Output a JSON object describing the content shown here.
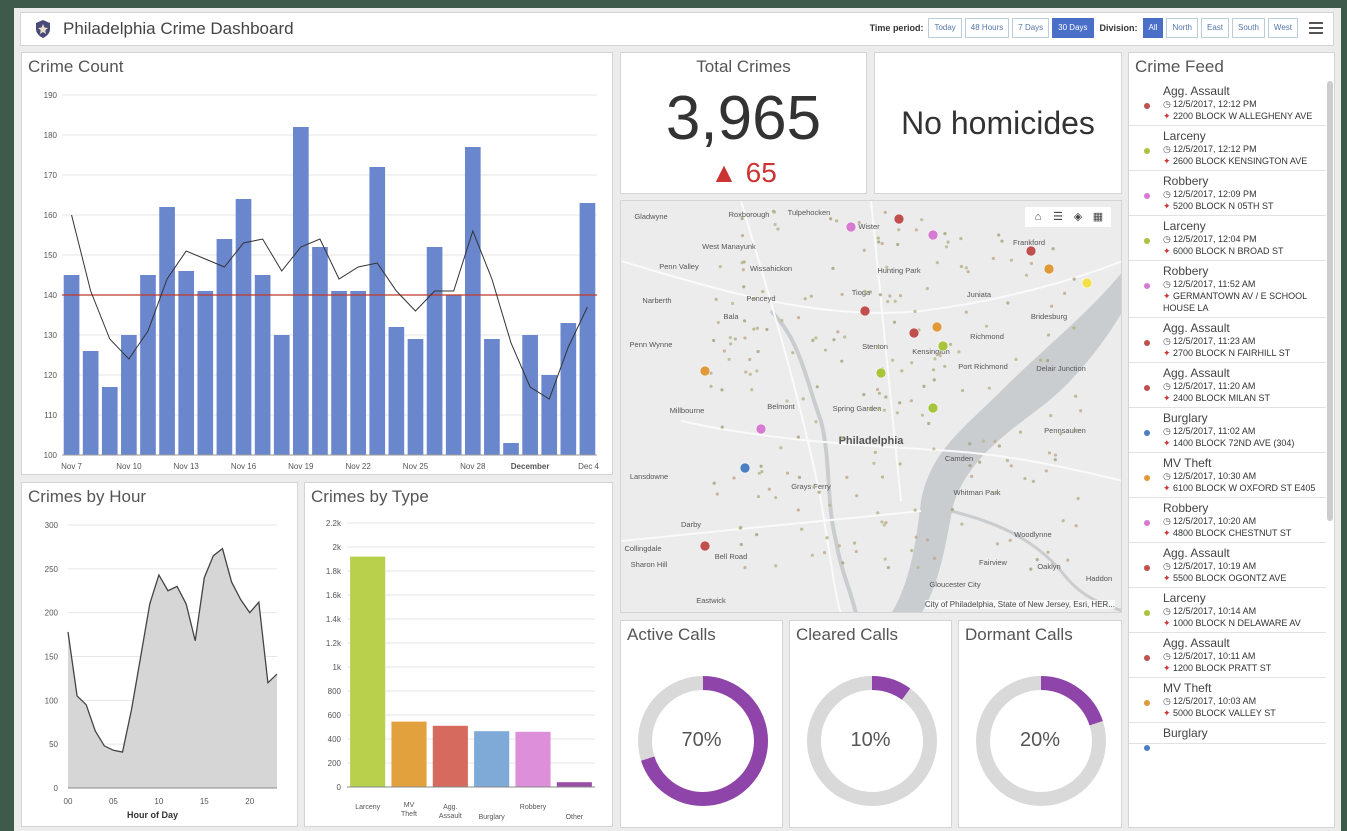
{
  "header": {
    "title": "Philadelphia Crime Dashboard",
    "time_label": "Time period:",
    "time_options": [
      "Today",
      "48 Hours",
      "7 Days",
      "30 Days"
    ],
    "time_selected": "30 Days",
    "division_label": "Division:",
    "division_options": [
      "All",
      "North",
      "East",
      "South",
      "West"
    ],
    "division_selected": "All"
  },
  "crime_count": {
    "title": "Crime Count",
    "chart_data": {
      "type": "bar",
      "title": "Crime Count",
      "yticks": [
        100,
        110,
        120,
        130,
        140,
        150,
        160,
        170,
        180,
        190
      ],
      "ylim": [
        100,
        190
      ],
      "xtick_labels": [
        "Nov 7",
        "Nov 10",
        "Nov 13",
        "Nov 16",
        "Nov 19",
        "Nov 22",
        "Nov 25",
        "Nov 28",
        "December",
        "Dec 4"
      ],
      "values": [
        145,
        126,
        117,
        130,
        145,
        162,
        146,
        141,
        154,
        164,
        145,
        130,
        182,
        152,
        141,
        141,
        172,
        132,
        129,
        152,
        140,
        177,
        129,
        103,
        130,
        120,
        133,
        163
      ],
      "trend": [
        160,
        141,
        129,
        124,
        131,
        144,
        151,
        149,
        147,
        153,
        154,
        146,
        152,
        154,
        144,
        147,
        148,
        141,
        136,
        141,
        141,
        156,
        144,
        128,
        117,
        114,
        127,
        137
      ],
      "reference_line": 140,
      "bar_color": "#6a86cc",
      "ref_color": "#c0392b",
      "grid": true
    }
  },
  "total_crimes": {
    "title": "Total Crimes",
    "value": "3,965",
    "delta": "▲ 65",
    "delta_color": "#c0392b"
  },
  "homicides": {
    "text": "No homicides"
  },
  "crimes_by_hour": {
    "title": "Crimes by Hour",
    "chart_data": {
      "type": "area",
      "title": "Crimes by Hour",
      "xlabel": "Hour of Day",
      "xticks": [
        "00",
        "05",
        "10",
        "15",
        "20"
      ],
      "yticks": [
        0,
        50,
        100,
        150,
        200,
        250,
        300
      ],
      "ylim": [
        0,
        300
      ],
      "x": [
        0,
        1,
        2,
        3,
        4,
        5,
        6,
        7,
        8,
        9,
        10,
        11,
        12,
        13,
        14,
        15,
        16,
        17,
        18,
        19,
        20,
        21,
        22,
        23
      ],
      "values": [
        178,
        105,
        95,
        65,
        48,
        43,
        41,
        90,
        150,
        210,
        243,
        225,
        230,
        210,
        168,
        240,
        265,
        273,
        235,
        215,
        200,
        212,
        120,
        130
      ]
    }
  },
  "crimes_by_type": {
    "title": "Crimes by Type",
    "chart_data": {
      "type": "bar",
      "title": "Crimes by Type",
      "yticks": [
        "0",
        "200",
        "400",
        "600",
        "800",
        "1k",
        "1.2k",
        "1.4k",
        "1.6k",
        "1.8k",
        "2k",
        "2.2k"
      ],
      "ylim": [
        0,
        2200
      ],
      "categories": [
        "Larceny",
        "MV Theft",
        "Agg. Assault",
        "Burglary",
        "Robbery",
        "Other"
      ],
      "category_lines": [
        [
          "Larceny"
        ],
        [
          "MV",
          "Theft"
        ],
        [
          "Agg.",
          "Assault"
        ],
        [
          "Burglary"
        ],
        [
          "Robbery"
        ],
        [
          "Other"
        ]
      ],
      "values": [
        1920,
        545,
        510,
        465,
        460,
        40
      ],
      "colors": [
        "#b8d04c",
        "#e3a13e",
        "#d66a5e",
        "#7fa9d6",
        "#dd8fd9",
        "#9a4fa6"
      ]
    }
  },
  "map": {
    "labels": [
      "Gladwyne",
      "Roxborough",
      "Tulpehocken",
      "Wister",
      "Frankford",
      "West Manayunk",
      "Penn Valley",
      "Wissahickon",
      "Hunting Park",
      "Narberth",
      "Penceyd",
      "Tioga",
      "Juniata",
      "Bridesburg",
      "Bala",
      "Richmond",
      "Penn Wynne",
      "Stenton",
      "Kensington",
      "Port Richmond",
      "Delair Junction",
      "Belmont",
      "Millbourne",
      "Spring Garden",
      "Philadelphia",
      "Pennsauken",
      "Camden",
      "Lansdowne",
      "Grays Ferry",
      "Whitman Park",
      "Darby",
      "Collingdale",
      "Bell Road",
      "Sharon Hill",
      "Woodlynne",
      "Fairview",
      "Oaklyn",
      "Haddon",
      "Gloucester City",
      "Eastwick"
    ],
    "attribution": "City of Philadelphia, State of New Jersey, Esri, HER..."
  },
  "calls": [
    {
      "title": "Active Calls",
      "value": "70%",
      "fraction": 0.7
    },
    {
      "title": "Cleared Calls",
      "value": "10%",
      "fraction": 0.1
    },
    {
      "title": "Dormant Calls",
      "value": "20%",
      "fraction": 0.2
    }
  ],
  "feed": {
    "title": "Crime Feed",
    "items": [
      {
        "type": "Agg. Assault",
        "time": "12/5/2017, 12:12 PM",
        "address": "2200 BLOCK W ALLEGHENY AVE",
        "color": "#c0504d"
      },
      {
        "type": "Larceny",
        "time": "12/5/2017, 12:12 PM",
        "address": "2600 BLOCK KENSINGTON AVE",
        "color": "#a8c43c"
      },
      {
        "type": "Robbery",
        "time": "12/5/2017, 12:09 PM",
        "address": "5200 BLOCK N 05TH ST",
        "color": "#d77ad1"
      },
      {
        "type": "Larceny",
        "time": "12/5/2017, 12:04 PM",
        "address": "6000 BLOCK N BROAD ST",
        "color": "#a8c43c"
      },
      {
        "type": "Robbery",
        "time": "12/5/2017, 11:52 AM",
        "address": "GERMANTOWN AV / E SCHOOL HOUSE LA",
        "color": "#d77ad1"
      },
      {
        "type": "Agg. Assault",
        "time": "12/5/2017, 11:23 AM",
        "address": "2700 BLOCK N FAIRHILL ST",
        "color": "#c0504d"
      },
      {
        "type": "Agg. Assault",
        "time": "12/5/2017, 11:20 AM",
        "address": "2400 BLOCK MILAN ST",
        "color": "#c0504d"
      },
      {
        "type": "Burglary",
        "time": "12/5/2017, 11:02 AM",
        "address": "1400 BLOCK 72ND AVE (304)",
        "color": "#4a7fc1"
      },
      {
        "type": "MV Theft",
        "time": "12/5/2017, 10:30 AM",
        "address": "6100 BLOCK W OXFORD ST E405",
        "color": "#e09a3a"
      },
      {
        "type": "Robbery",
        "time": "12/5/2017, 10:20 AM",
        "address": "4800 BLOCK CHESTNUT ST",
        "color": "#d77ad1"
      },
      {
        "type": "Agg. Assault",
        "time": "12/5/2017, 10:19 AM",
        "address": "5500 BLOCK OGONTZ AVE",
        "color": "#c0504d"
      },
      {
        "type": "Larceny",
        "time": "12/5/2017, 10:14 AM",
        "address": "1000 BLOCK N DELAWARE AV",
        "color": "#a8c43c"
      },
      {
        "type": "Agg. Assault",
        "time": "12/5/2017, 10:11 AM",
        "address": "1200 BLOCK PRATT ST",
        "color": "#c0504d"
      },
      {
        "type": "MV Theft",
        "time": "12/5/2017, 10:03 AM",
        "address": "5000 BLOCK VALLEY ST",
        "color": "#e09a3a"
      },
      {
        "type": "Burglary",
        "time": "",
        "address": "",
        "color": "#4a7fc1"
      }
    ]
  }
}
